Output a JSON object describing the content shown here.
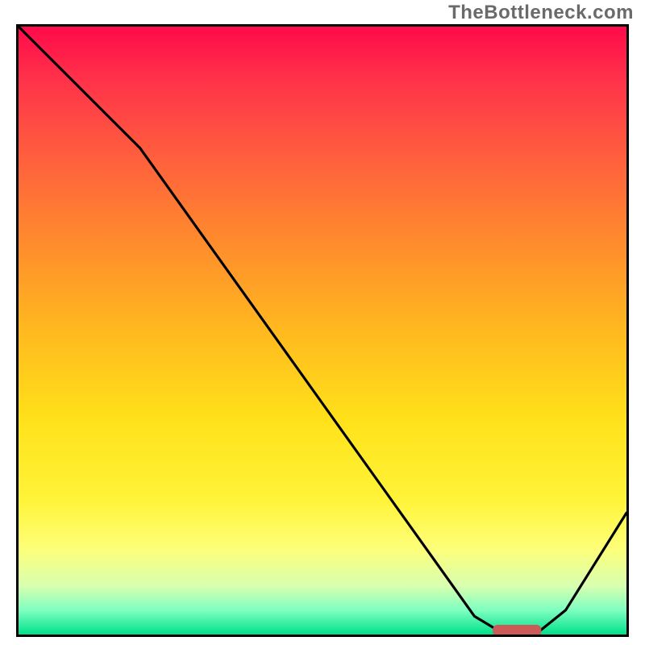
{
  "watermark": "TheBottleneck.com",
  "chart_data": {
    "type": "line",
    "title": "",
    "xlabel": "",
    "ylabel": "",
    "xlim": [
      0,
      100
    ],
    "ylim": [
      0,
      100
    ],
    "legend": null,
    "grid": false,
    "background": "rainbow-vertical-gradient",
    "series": [
      {
        "name": "bottleneck-curve",
        "x": [
          0,
          10,
          20,
          30,
          40,
          50,
          60,
          70,
          75,
          80,
          85,
          90,
          100
        ],
        "y": [
          100,
          90,
          80,
          66,
          52,
          38,
          24,
          10,
          3,
          0,
          0,
          4,
          20
        ]
      }
    ],
    "optimal_marker": {
      "x_range": [
        78,
        86
      ],
      "y": 0,
      "color": "#cc5a58"
    }
  }
}
